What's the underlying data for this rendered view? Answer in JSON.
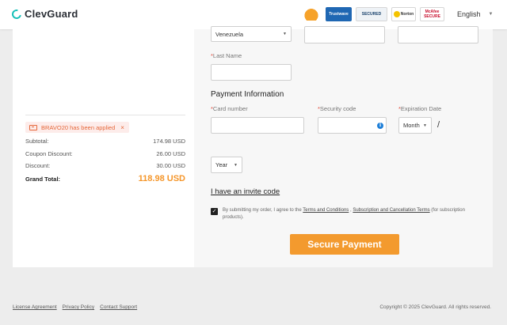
{
  "header": {
    "logo_text": "ClevGuard",
    "badges": [
      {
        "name": "award-badge",
        "text": ""
      },
      {
        "name": "trustwave-badge",
        "text": "Trustwave"
      },
      {
        "name": "ssl-secured-badge",
        "text": "SECURED"
      },
      {
        "name": "norton-badge",
        "text": "Norton"
      },
      {
        "name": "mcafee-badge",
        "text": "McAfee SECURE"
      }
    ],
    "language": "English"
  },
  "summary": {
    "coupon_text": "BRAVO20 has been applied",
    "coupon_close": "×",
    "rows": [
      {
        "label": "Subtotal:",
        "value": "174.98 USD"
      },
      {
        "label": "Coupon Discount:",
        "value": "26.00 USD"
      },
      {
        "label": "Discount:",
        "value": "30.00 USD"
      }
    ],
    "grand_total_label": "Grand Total:",
    "grand_total_value": "118.98 USD"
  },
  "form": {
    "country_value": "Venezuela",
    "last_name_label": "Last Name",
    "payment_title": "Payment Information",
    "card_number_label": "Card number",
    "security_code_label": "Security code",
    "expiration_label": "Expiration Date",
    "month_value": "Month",
    "year_value": "Year",
    "required_mark": "*",
    "slash": "/",
    "invite_text": "I have an invite code",
    "agree_prefix": "By submitting my order, I agree to the ",
    "terms_link": "Terms and Conditions",
    "agree_mid": " , ",
    "subscription_link": "Subscription and Cancellation Terms",
    "agree_suffix": " (for subscription products).",
    "pay_button": "Secure Payment"
  },
  "footer": {
    "links": [
      "License Agreement",
      "Privacy Policy",
      "Contact Support"
    ],
    "copyright": "Copyright © 2025 ClevGuard. All rights reserved."
  },
  "colors": {
    "accent": "#f39a2e",
    "teal": "#16c0b8",
    "required": "#e14a3a",
    "coupon": "#e5683a"
  }
}
